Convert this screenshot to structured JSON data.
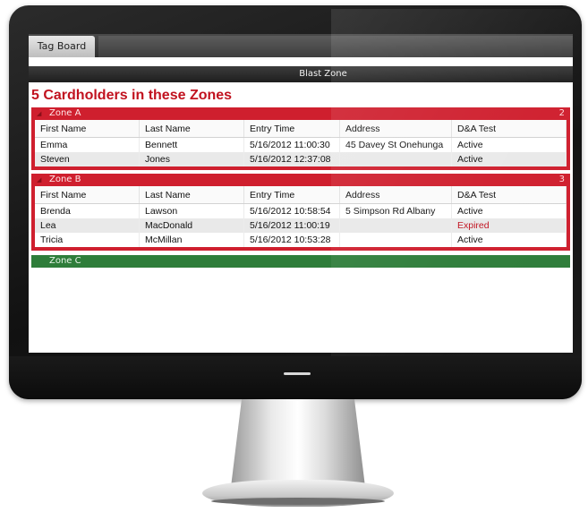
{
  "app": {
    "tab_label": "Tag Board",
    "header_title": "Blast Zone",
    "page_title": "5 Cardholders in these Zones"
  },
  "columns": [
    "First Name",
    "Last Name",
    "Entry Time",
    "Address",
    "D&A Test"
  ],
  "zones": [
    {
      "name": "Zone A",
      "count": "2",
      "rows": [
        [
          "Emma",
          "Bennett",
          "5/16/2012 11:00:30",
          "45 Davey St Onehunga",
          "Active"
        ],
        [
          "Steven",
          "Jones",
          "5/16/2012 12:37:08",
          "",
          "Active"
        ]
      ]
    },
    {
      "name": "Zone B",
      "count": "3",
      "rows": [
        [
          "Brenda",
          "Lawson",
          "5/16/2012 10:58:54",
          "5 Simpson Rd Albany",
          "Active"
        ],
        [
          "Lea",
          "MacDonald",
          "5/16/2012 11:00:19",
          "",
          "Expired"
        ],
        [
          "Tricia",
          "McMillan",
          "5/16/2012 10:53:28",
          "",
          "Active"
        ]
      ]
    }
  ],
  "zone_c": {
    "name": "Zone C"
  },
  "colors": {
    "zone_red": "#cf1f2e",
    "zone_green": "#2e7d3a",
    "title_red": "#c1121f"
  },
  "icons": {
    "zone_toggle": "collapse-triangle-icon"
  }
}
